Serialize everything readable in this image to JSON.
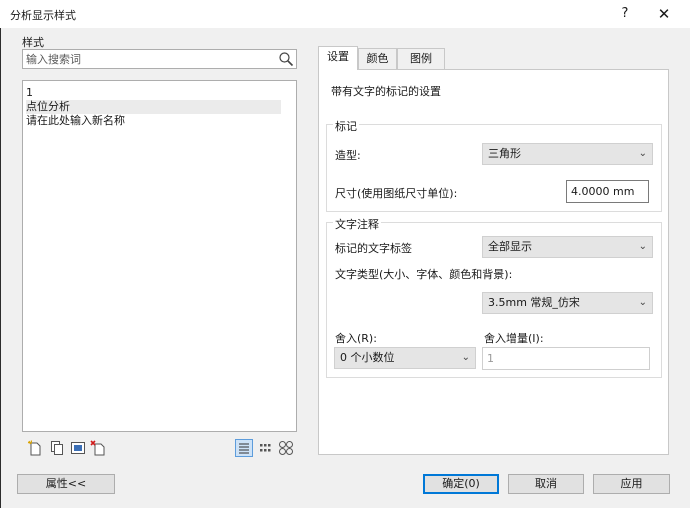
{
  "window": {
    "title": "分析显示样式",
    "help_label": "?",
    "close_label": "✕"
  },
  "left": {
    "styles_label": "样式",
    "search_placeholder": "输入搜索词",
    "items": [
      {
        "label": "1"
      },
      {
        "label": "点位分析"
      },
      {
        "label": "请在此处输入新名称"
      }
    ]
  },
  "tabs": [
    {
      "label": "设置"
    },
    {
      "label": "颜色"
    },
    {
      "label": "图例"
    }
  ],
  "settings": {
    "heading": "带有文字的标记的设置",
    "marker_group": {
      "title": "标记",
      "shape_label": "造型:",
      "shape_value": "三角形",
      "size_label": "尺寸(使用图纸尺寸单位):",
      "size_value": "4.0000 mm"
    },
    "text_group": {
      "title": "文字注释",
      "tag_label": "标记的文字标签",
      "tag_value": "全部显示",
      "type_label": "文字类型(大小、字体、颜色和背景):",
      "type_value": "3.5mm 常规_仿宋",
      "rounding_label": "舍入(R):",
      "rounding_value": "0 个小数位",
      "increment_label": "舍入增量(I):",
      "increment_value": "1"
    }
  },
  "footer": {
    "properties_label": "属性<<",
    "ok_label": "确定(0)",
    "cancel_label": "取消",
    "apply_label": "应用"
  },
  "colors": {
    "accent": "#0078d7",
    "view_active_bg": "#cde2f7"
  }
}
